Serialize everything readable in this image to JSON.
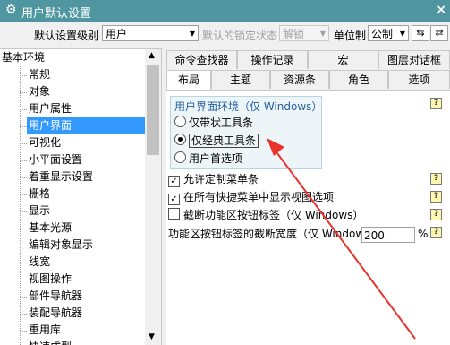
{
  "window": {
    "title": "用户默认设置",
    "close": "×"
  },
  "toolbar": {
    "level_label": "默认设置级别",
    "level_value": "用户",
    "lock_label": "默认的锁定状态",
    "lock_value": "解锁",
    "unit_label": "单位制",
    "unit_value": "公制"
  },
  "tree": {
    "root": "基本环境",
    "items": [
      "常规",
      "对象",
      "用户属性",
      "用户界面",
      "可视化",
      "小平面设置",
      "着重显示设置",
      "栅格",
      "显示",
      "基本光源",
      "编辑对象显示",
      "线宽",
      "视图操作",
      "部件导航器",
      "装配导航器",
      "重用库",
      "快速成型"
    ],
    "selected_index": 3
  },
  "tabs_row1": [
    "命令查找器",
    "操作记录",
    "宏",
    "图层对话框"
  ],
  "tabs_row2": [
    "布局",
    "主题",
    "资源条",
    "角色",
    "选项"
  ],
  "active_tab": "布局",
  "group": {
    "title": "用户界面环境（仅 Windows）",
    "options": [
      "仅带状工具条",
      "仅经典工具条",
      "用户首选项"
    ],
    "selected_index": 1
  },
  "checks": [
    {
      "label": "允许定制菜单条",
      "checked": true
    },
    {
      "label": "在所有快捷菜单中显示视图选项",
      "checked": true
    },
    {
      "label": "截断功能区按钮标签（仅 Windows）",
      "checked": false
    }
  ],
  "width_row": {
    "label": "功能区按钮标签的截断宽度（仅 Window",
    "value": "200",
    "unit": "%"
  },
  "help_glyph": "?",
  "colors": {
    "titlebar": "#4f96a1",
    "selection": "#3399ff",
    "arrow": "#e8342c"
  }
}
